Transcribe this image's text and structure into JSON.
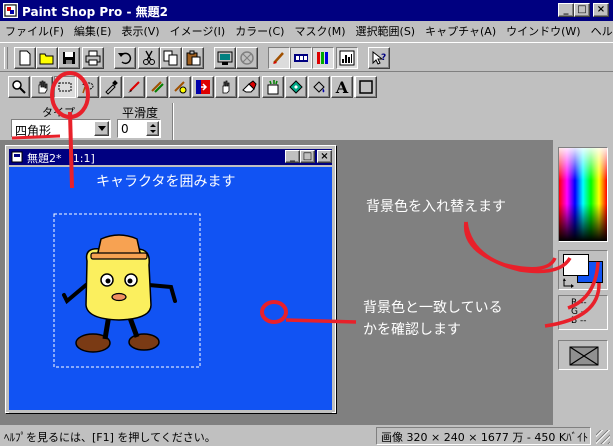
{
  "window": {
    "title": "Paint Shop Pro - 無題2",
    "minimize_glyph": "_",
    "maximize_glyph": "□",
    "close_glyph": "×"
  },
  "menu": {
    "items": [
      "ファイル(F)",
      "編集(E)",
      "表示(V)",
      "イメージ(I)",
      "カラー(C)",
      "マスク(M)",
      "選択範囲(S)",
      "キャプチャ(A)",
      "ウインドウ(W)",
      "ヘルプ(H)"
    ]
  },
  "toolbar_main": {
    "icons": [
      "new-icon",
      "open-icon",
      "save-icon",
      "print-icon",
      "undo-icon",
      "cut-icon",
      "copy-icon",
      "paste-icon",
      "capture-icon",
      "cancel-capture-icon",
      "brush-toggle-icon",
      "toolbar-toggle-icon",
      "palette-toggle-icon",
      "histogram-icon",
      "help-pointer-icon"
    ]
  },
  "toolbar_tools": {
    "icons": [
      "zoom-icon",
      "pan-icon",
      "select-icon",
      "lasso-icon",
      "dropper-icon",
      "paintbrush-icon",
      "clone-icon",
      "color-replacer-icon",
      "retouch-icon",
      "eraser-icon",
      "picture-tube-icon",
      "airbrush-icon",
      "flood-fill-icon",
      "text-icon",
      "line-icon",
      "shape-icon"
    ],
    "text_tool_glyph": "A"
  },
  "options": {
    "type_label": "タイプ",
    "type_value": "四角形",
    "smoothing_label": "平滑度",
    "smoothing_value": "0"
  },
  "document": {
    "title": "無題2*  [1:1]"
  },
  "annotations": {
    "enclose_character": "キャラクタを囲みます",
    "swap_background": "背景色を入れ替えます",
    "check_match_line1": "背景色と一致している",
    "check_match_line2": "かを確認します"
  },
  "color_panel": {
    "rgb_r": "R --",
    "rgb_g": "G --",
    "rgb_b": "B --",
    "foreground_color": "#ffffff",
    "background_color": "#1153f3"
  },
  "colors": {
    "canvas_blue": "#1153f3",
    "annotation_red": "#e8202a",
    "titlebar_navy": "#000080"
  },
  "status": {
    "help_text": "ﾍﾙﾌﾟを見るには、[F1] を押してください。",
    "image_info": "画像  320 × 240 × 1677 万 - 450 Kﾊﾞｲﾄ"
  }
}
